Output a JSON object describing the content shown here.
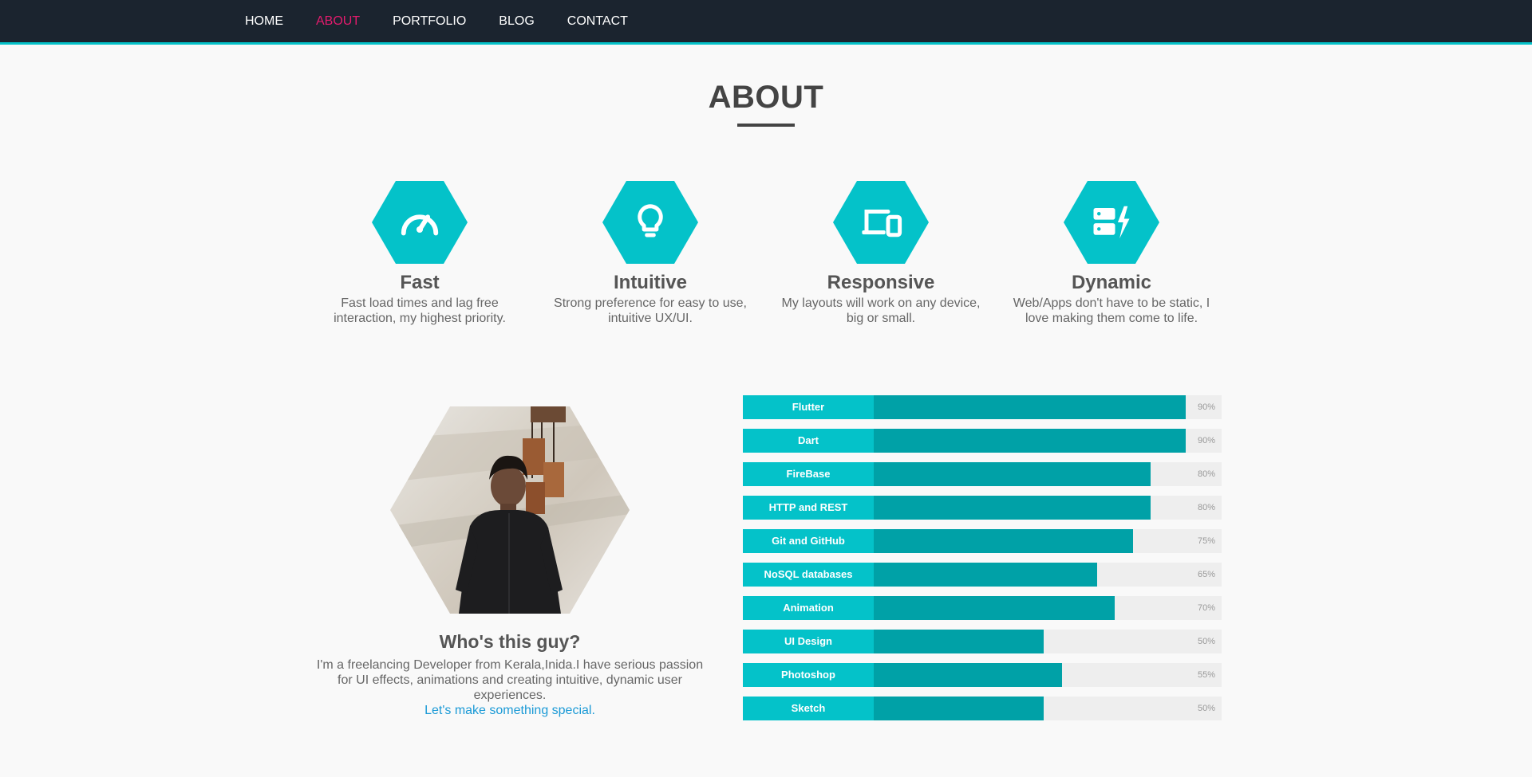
{
  "nav": {
    "items": [
      {
        "label": "HOME"
      },
      {
        "label": "ABOUT",
        "active": true
      },
      {
        "label": "PORTFOLIO"
      },
      {
        "label": "BLOG"
      },
      {
        "label": "CONTACT"
      }
    ]
  },
  "about": {
    "title": "ABOUT"
  },
  "features": [
    {
      "icon": "speedometer-icon",
      "title": "Fast",
      "text": "Fast load times and lag free interaction, my highest priority."
    },
    {
      "icon": "lightbulb-icon",
      "title": "Intuitive",
      "text": "Strong preference for easy to use, intuitive UX/UI."
    },
    {
      "icon": "devices-icon",
      "title": "Responsive",
      "text": "My layouts will work on any device, big or small."
    },
    {
      "icon": "server-bolt-icon",
      "title": "Dynamic",
      "text": "Web/Apps don't have to be static, I love making them come to life."
    }
  ],
  "profile": {
    "title": "Who's this guy?",
    "text": "I'm a freelancing Developer from Kerala,Inida.I have serious passion for UI effects, animations and creating intuitive, dynamic user experiences.",
    "link": "Let's make something special."
  },
  "skills": [
    {
      "name": "Flutter",
      "percent": 90,
      "label": "90%"
    },
    {
      "name": "Dart",
      "percent": 90,
      "label": "90%"
    },
    {
      "name": "FireBase",
      "percent": 80,
      "label": "80%"
    },
    {
      "name": "HTTP and REST",
      "percent": 80,
      "label": "80%"
    },
    {
      "name": "Git and GitHub",
      "percent": 75,
      "label": "75%"
    },
    {
      "name": "NoSQL databases",
      "percent": 65,
      "label": "65%"
    },
    {
      "name": "Animation",
      "percent": 70,
      "label": "70%"
    },
    {
      "name": "UI Design",
      "percent": 50,
      "label": "50%"
    },
    {
      "name": "Photoshop",
      "percent": 55,
      "label": "55%"
    },
    {
      "name": "Sketch",
      "percent": 50,
      "label": "50%"
    }
  ],
  "colors": {
    "nav_bg": "#1b242f",
    "accent": "#04c2c9",
    "bar_fill": "#00a1a7",
    "active_link": "#e31b6d",
    "link": "#1b9ad6"
  }
}
